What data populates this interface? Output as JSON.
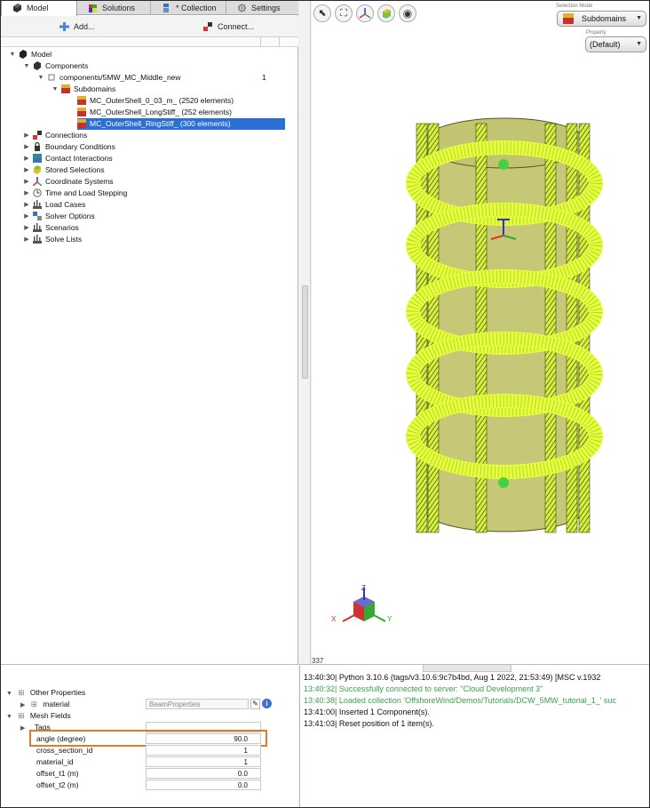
{
  "tabs": [
    {
      "label": "Model",
      "active": true,
      "icon": "model-cube-icon"
    },
    {
      "label": "Solutions",
      "active": false,
      "icon": "solutions-cube-icon"
    },
    {
      "label": "* Collection",
      "active": false,
      "icon": "collection-icon"
    },
    {
      "label": "Settings",
      "active": false,
      "icon": "gear-icon"
    }
  ],
  "toolbar": {
    "add_label": "Add...",
    "connect_label": "Connect..."
  },
  "tree": {
    "model": "Model",
    "components": "Components",
    "component_file": "components/5MW_MC_Middle_new",
    "component_count": "1",
    "subdomains": "Subdomains",
    "subdomain_items": [
      "MC_OuterShell_0_03_m_ (2520 elements)",
      "MC_OuterShell_LongStiff_ (252 elements)",
      "MC_OuterShell_RingStiff_ (300 elements)"
    ],
    "connections": "Connections",
    "boundary_conditions": "Boundary Conditions",
    "contact_interactions": "Contact Interactions",
    "stored_selections": "Stored Selections",
    "coordinate_systems": "Coordinate Systems",
    "time_load_stepping": "Time and Load Stepping",
    "load_cases": "Load Cases",
    "solver_options": "Solver Options",
    "scenarios": "Scenarios",
    "solve_lists": "Solve Lists"
  },
  "viewport": {
    "selection_mode_label": "Selection Mode",
    "selection_mode_value": "Subdomains",
    "property_label": "Property",
    "property_value": "(Default)",
    "status_number": "337",
    "axis_x": "X",
    "axis_y": "Y",
    "axis_z": "Z",
    "model_color": "#d8f040"
  },
  "properties": {
    "other_properties": "Other Properties",
    "material_label": "material",
    "material_value": "BeamProperties",
    "mesh_fields": "Mesh Fields",
    "tags_label": "Tags",
    "angle_label": "angle (degree)",
    "angle_value": "90.0",
    "cross_section_label": "cross_section_id",
    "cross_section_value": "1",
    "material_id_label": "material_id",
    "material_id_value": "1",
    "offset_t1_label": "offset_t1 (m)",
    "offset_t1_value": "0.0",
    "offset_t2_label": "offset_t2 (m)",
    "offset_t2_value": "0.0"
  },
  "console": {
    "lines": [
      {
        "text": "13:40:30| Python 3.10.6 (tags/v3.10.6:9c7b4bd, Aug  1 2022, 21:53:49) [MSC v.1932",
        "color": "normal"
      },
      {
        "text": "13:40:32| Successfully connected to server: \"Cloud Development 3\"",
        "color": "green"
      },
      {
        "text": "13:40:38| Loaded collection 'OffshoreWind/Demos/Tutorials/DCW_5MW_tutorial_1_' suc",
        "color": "green"
      },
      {
        "text": "13:41:00| Inserted 1 Component(s).",
        "color": "normal"
      },
      {
        "text": "13:41:03| Reset position of 1 item(s).",
        "color": "normal"
      }
    ]
  }
}
